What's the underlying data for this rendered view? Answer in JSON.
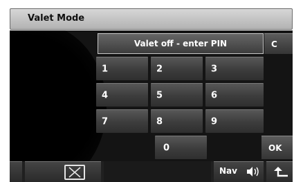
{
  "title": "Valet Mode",
  "prompt": "Valet off - enter PIN",
  "keypad": {
    "k1": "1",
    "k2": "2",
    "k3": "3",
    "k4": "4",
    "k5": "5",
    "k6": "6",
    "k7": "7",
    "k8": "8",
    "k9": "9",
    "k0": "0"
  },
  "clear_label": "C",
  "ok_label": "OK",
  "bottom": {
    "nav_label": "Nav",
    "icons": [
      "close-icon",
      "volume-icon",
      "back-icon"
    ]
  },
  "colors": {
    "title_bar": "#c4c4c4",
    "panel": "#141414",
    "key": "#474747",
    "text": "#ffffff"
  }
}
